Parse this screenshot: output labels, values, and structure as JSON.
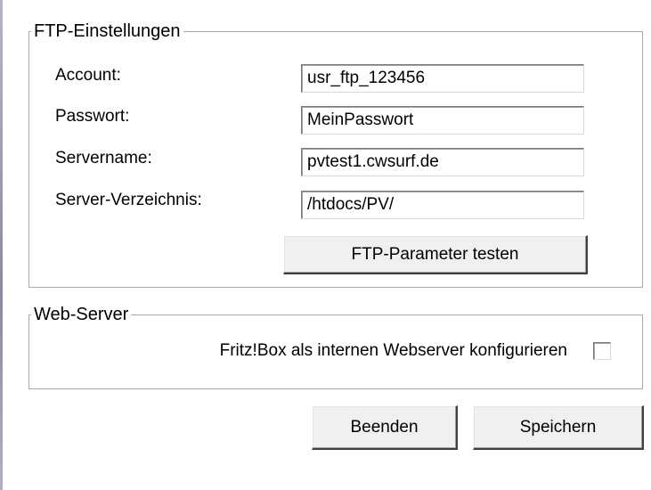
{
  "ftp_settings": {
    "title": "FTP-Einstellungen",
    "fields": [
      {
        "label": "Account:",
        "value": "usr_ftp_123456"
      },
      {
        "label": "Passwort:",
        "value": "MeinPasswort"
      },
      {
        "label": "Servername:",
        "value": "pvtest1.cwsurf.de"
      },
      {
        "label": "Server-Verzeichnis:",
        "value": "/htdocs/PV/"
      }
    ],
    "test_button_label": "FTP-Parameter testen"
  },
  "web_server": {
    "title": "Web-Server",
    "checkbox_label": "Fritz!Box als internen Webserver konfigurieren",
    "checkbox_checked": false
  },
  "buttons": {
    "quit_label": "Beenden",
    "save_label": "Speichern"
  }
}
